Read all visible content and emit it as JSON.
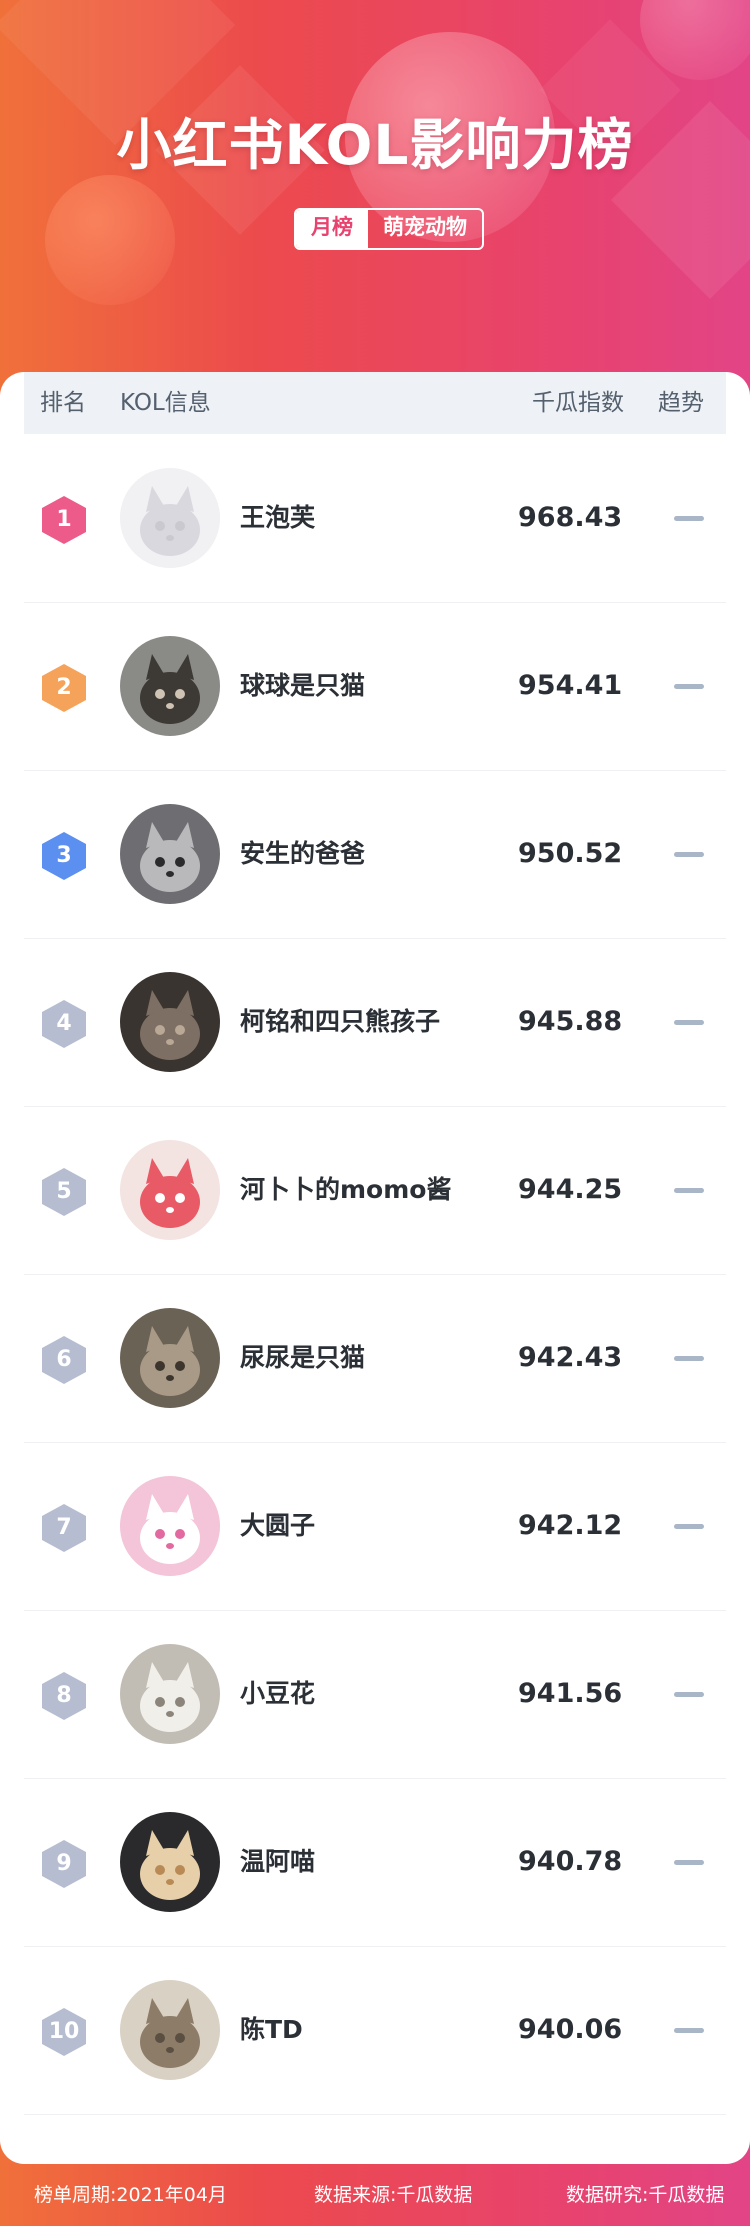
{
  "header": {
    "title": "小红书KOL影响力榜",
    "tag_period": "月榜",
    "tag_category": "萌宠动物"
  },
  "table": {
    "col_rank": "排名",
    "col_kol": "KOL信息",
    "col_index": "千瓜指数",
    "col_trend": "趋势"
  },
  "rows": [
    {
      "rank": "1",
      "name": "王泡芙",
      "score": "968.43",
      "badge_color": "#ec5b8a",
      "avatar": "white-hooded-cat-avatar"
    },
    {
      "rank": "2",
      "name": "球球是只猫",
      "score": "954.41",
      "badge_color": "#f5a25a",
      "avatar": "person-with-cat-avatar"
    },
    {
      "rank": "3",
      "name": "安生的爸爸",
      "score": "950.52",
      "badge_color": "#5b8ff0",
      "avatar": "gray-cat-avatar"
    },
    {
      "rank": "4",
      "name": "柯铭和四只熊孩子",
      "score": "945.88",
      "badge_color": "#b6bdd0",
      "avatar": "cats-group-avatar"
    },
    {
      "rank": "5",
      "name": "河卜卜的momo酱",
      "score": "944.25",
      "badge_color": "#b6bdd0",
      "avatar": "white-cat-red-hat-avatar"
    },
    {
      "rank": "6",
      "name": "尿尿是只猫",
      "score": "942.43",
      "badge_color": "#b6bdd0",
      "avatar": "tabby-cat-avatar"
    },
    {
      "rank": "7",
      "name": "大圆子",
      "score": "942.12",
      "badge_color": "#b6bdd0",
      "avatar": "white-cat-pink-avatar"
    },
    {
      "rank": "8",
      "name": "小豆花",
      "score": "941.56",
      "badge_color": "#b6bdd0",
      "avatar": "white-kitten-avatar"
    },
    {
      "rank": "9",
      "name": "温阿喵",
      "score": "940.78",
      "badge_color": "#b6bdd0",
      "avatar": "fluffy-cat-avatar"
    },
    {
      "rank": "10",
      "name": "陈TD",
      "score": "940.06",
      "badge_color": "#b6bdd0",
      "avatar": "kitten-avatar"
    }
  ],
  "trend_icon": "flat-dash-icon",
  "footer": {
    "period": "榜单周期:2021年04月",
    "source": "数据来源:千瓜数据",
    "research": "数据研究:千瓜数据"
  },
  "colors": {
    "accent": "#e8436e",
    "gradient_start": "#f0703a",
    "gradient_end": "#e24486",
    "trend": "#a9b6c7"
  }
}
